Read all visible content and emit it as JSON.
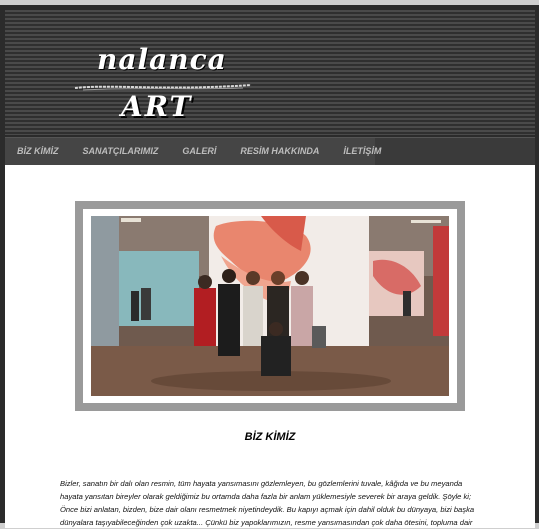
{
  "header": {
    "logo_top": "nalanca",
    "logo_bottom": "ART"
  },
  "nav": {
    "items": [
      {
        "label": "BİZ KİMİZ"
      },
      {
        "label": "SANATÇILARIMIZ"
      },
      {
        "label": "GALERİ"
      },
      {
        "label": "RESİM HAKKINDA"
      },
      {
        "label": "İLETİŞİM"
      }
    ]
  },
  "main": {
    "section_title": "BİZ KİMİZ",
    "body_text": "Bizler, sanatın bir dalı olan resmin, tüm hayata yansımasını gözlemleyen, bu gözlemlerini tuvale, kâğıda ve bu meyanda hayata yansıtan bireyler olarak geldiğimiz bu ortamda daha fazla bir anlam yüklemesiyle severek bir araya geldik. Şöyle ki; Önce bizi anlatan, bizden, bize dair olanı resmetmek niyetindeydik. Bu kapıyı açmak için dahil olduk bu dünyaya, bizi başka dünyalara taşıyabileceğinden çok uzakta... Çünkü biz yapoklarımızın, resme yansımasından çok daha ötesini, topluma dair"
  },
  "colors": {
    "header_bg": "#3a3a3a",
    "nav_bg": "#454545",
    "nav_text": "#bdbdbd",
    "photo_frame": "#9a9a9a",
    "content_bg": "#ffffff"
  }
}
